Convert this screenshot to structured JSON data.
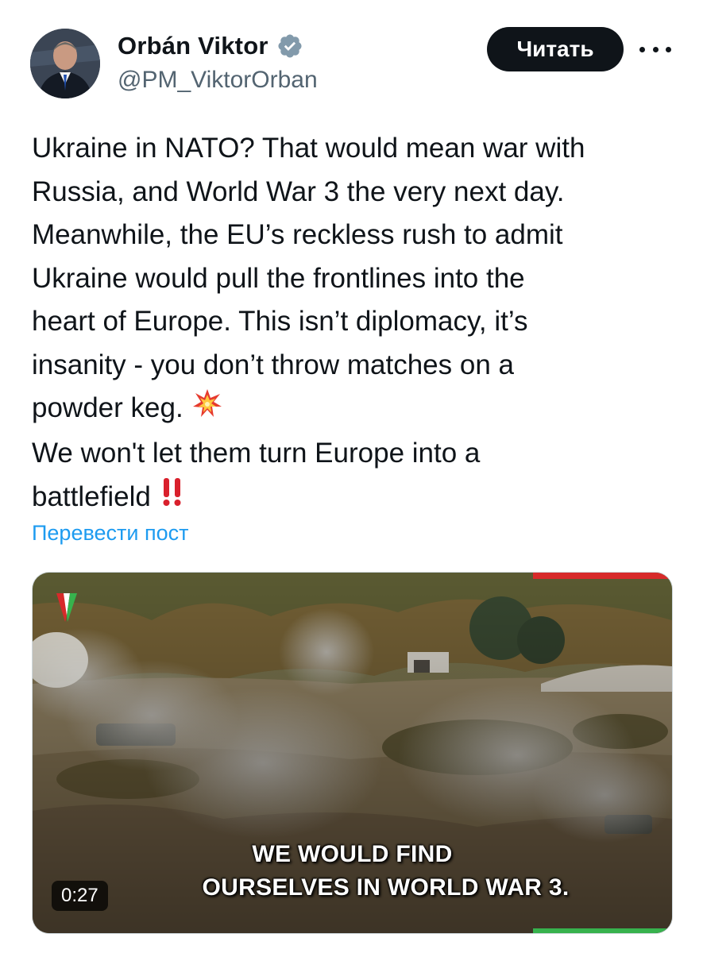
{
  "author": {
    "display_name": "Orbán Viktor",
    "handle": "@PM_ViktorOrban",
    "verified": true,
    "avatar_icon": "profile-photo"
  },
  "actions": {
    "follow_label": "Читать",
    "more_icon": "more-horizontal-icon"
  },
  "tweet": {
    "lines": [
      "Ukraine in NATO? That would mean war with",
      "Russia, and World War 3 the very next day.",
      "Meanwhile, the EU’s reckless rush to admit",
      "Ukraine would pull the frontlines into the",
      "heart of Europe. This isn’t diplomacy, it’s",
      "insanity - you don’t throw matches on a",
      "powder keg.",
      "We won't let them turn Europe into a",
      "battlefield"
    ],
    "emoji_after_line_7": "💥",
    "emoji_after_line_9": "‼️",
    "translate_label": "Перевести пост"
  },
  "media": {
    "type": "video",
    "caption_line_1": "WE WOULD FIND",
    "caption_line_2": "OURSELVES IN WORLD WAR 3.",
    "duration": "0:27"
  },
  "colors": {
    "link": "#1d9bf0",
    "verified_badge": "#829aab",
    "button_bg": "#0f1419",
    "accent_red": "#d72a2a",
    "accent_green": "#37b24d"
  }
}
